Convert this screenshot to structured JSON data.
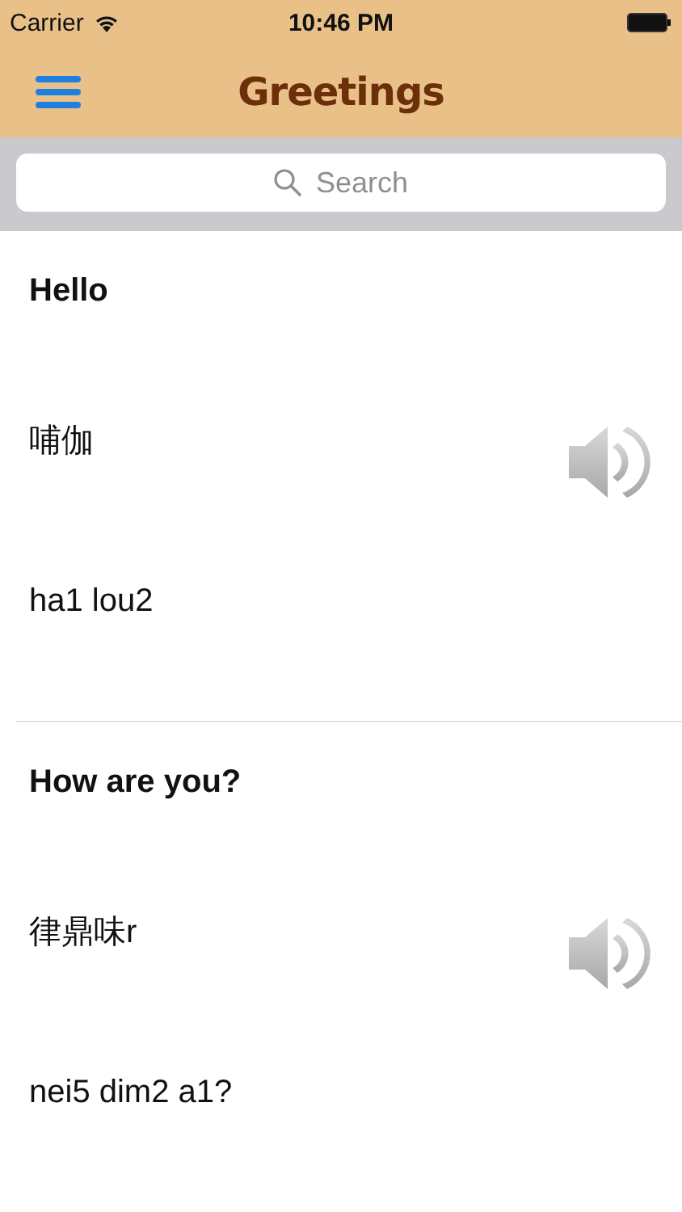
{
  "status_bar": {
    "carrier": "Carrier",
    "time": "10:46 PM"
  },
  "nav_bar": {
    "title": "Greetings"
  },
  "search": {
    "placeholder": "Search"
  },
  "phrases": [
    {
      "english": "Hello",
      "chinese": "哺伽",
      "romanization": "ha1 lou2"
    },
    {
      "english": "How are you?",
      "chinese": "律鼎味r",
      "romanization": "nei5 dim2 a1?"
    }
  ]
}
